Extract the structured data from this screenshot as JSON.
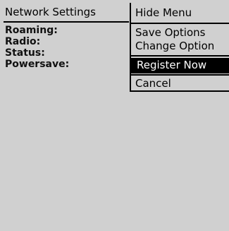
{
  "screen": {
    "title": "Network Settings",
    "fields": [
      {
        "label": "Roaming:"
      },
      {
        "label": "Radio:"
      },
      {
        "label": "Status:"
      },
      {
        "label": "Powersave:"
      }
    ]
  },
  "menu": {
    "hide_label": "Hide Menu",
    "items": [
      {
        "label": "Save Options"
      },
      {
        "label": "Change Option"
      },
      {
        "label": "Register Now"
      },
      {
        "label": "Cancel"
      }
    ],
    "selected_item": "Register Now"
  },
  "colors": {
    "background": "#d0d0d0",
    "text": "#000000",
    "highlight_bg": "#000000",
    "highlight_text": "#ffffff"
  }
}
